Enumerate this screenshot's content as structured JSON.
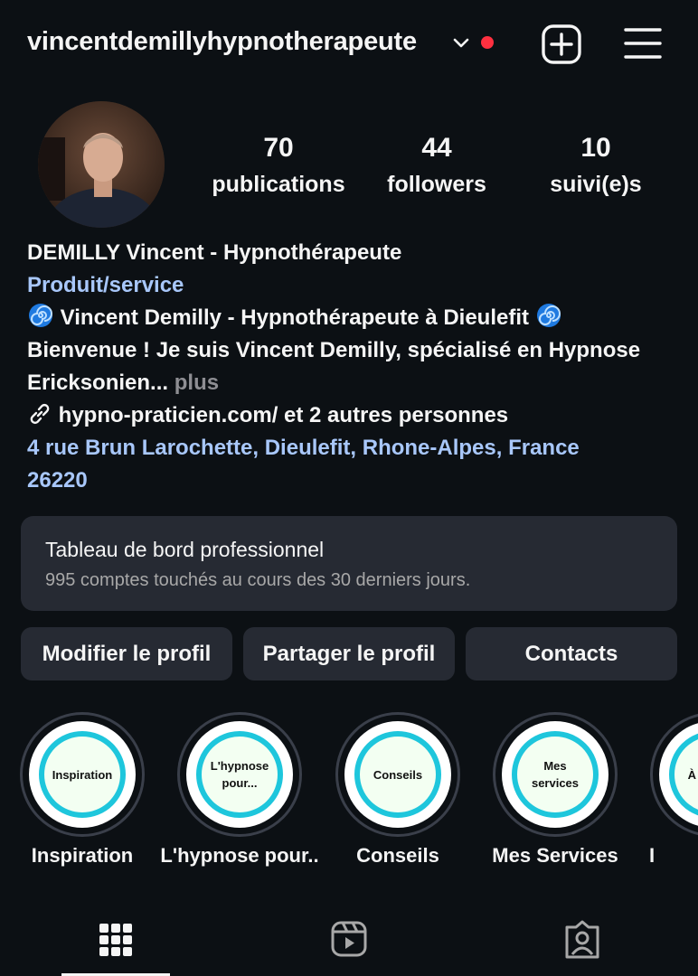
{
  "header": {
    "username": "vincentdemillyhypnotherapeute"
  },
  "stats": [
    {
      "value": "70",
      "label": "publications"
    },
    {
      "value": "44",
      "label": "followers"
    },
    {
      "value": "10",
      "label": "suivi(e)s"
    }
  ],
  "bio": {
    "name": "DEMILLY Vincent - Hypnothérapeute",
    "category": "Produit/service",
    "headline": "Vincent Demilly - Hypnothérapeute à Dieulefit",
    "line2": "Bienvenue ! Je suis Vincent Demilly, spécialisé en Hypnose",
    "line3": "Ericksonien...",
    "more": "plus",
    "links": "hypno-praticien.com/ et 2 autres personnes",
    "address_line1": "4 rue Brun Larochette, Dieulefit, Rhone-Alpes, France",
    "address_line2": "26220"
  },
  "dashboard": {
    "title": "Tableau de bord professionnel",
    "subtitle": "995 comptes touchés au cours des 30 derniers jours."
  },
  "actions": {
    "edit": "Modifier le profil",
    "share": "Partager le profil",
    "contacts": "Contacts"
  },
  "highlights": [
    {
      "cover": "Inspiration",
      "label": "Inspiration"
    },
    {
      "cover": "L'hypnose pour...",
      "label": "L'hypnose pour.."
    },
    {
      "cover": "Conseils",
      "label": "Conseils"
    },
    {
      "cover": "Mes services",
      "label": "Mes Services"
    },
    {
      "cover": "À P... D...",
      "label": "I"
    }
  ],
  "tabs": [
    "grid-icon",
    "reels-icon",
    "tagged-icon"
  ],
  "colors": {
    "background": "#0c1014",
    "link": "#a8c7fa",
    "notification_dot": "#ff3040",
    "highlight_ring": "#1ec6dc",
    "surface": "#262a33"
  }
}
